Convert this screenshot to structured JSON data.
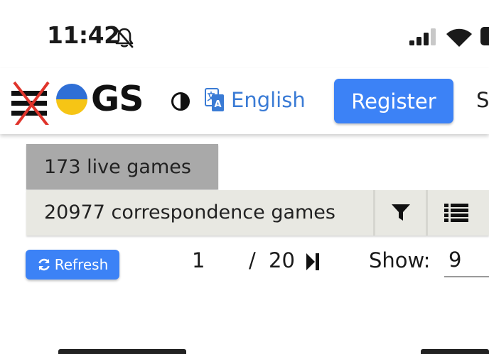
{
  "status_bar": {
    "time": "11:42"
  },
  "header": {
    "logo_text": "GS",
    "language_label": "English",
    "register_label": "Register",
    "clipped_label": "S"
  },
  "tabs": {
    "live": "173 live games",
    "correspondence": "20977 correspondence games"
  },
  "pagination": {
    "refresh_label": "Refresh",
    "current_page": "1",
    "separator": "/",
    "total_pages": "20",
    "show_label": "Show:",
    "show_value": "9"
  },
  "colors": {
    "accent": "#3c82f6",
    "link": "#3a7bd5",
    "live_tab_bg": "#a9a9a9",
    "corr_bar_bg": "#e8e8e2",
    "menu_cross": "#e0342b",
    "flag_blue": "#2f6fd6",
    "flag_yellow": "#f6c515"
  },
  "icons": [
    "bell-slash-icon",
    "signal-icon",
    "wifi-icon",
    "battery-icon",
    "menu-icon",
    "ukraine-flag-icon",
    "contrast-icon",
    "translate-icon",
    "filter-icon",
    "list-icon",
    "refresh-icon",
    "skip-to-end-icon"
  ]
}
